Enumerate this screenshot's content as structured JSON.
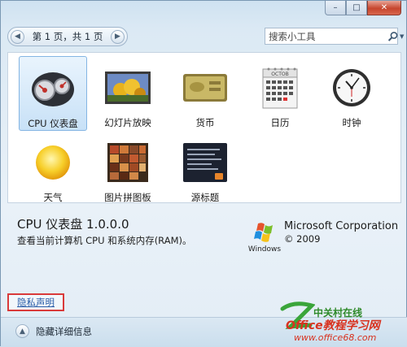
{
  "window": {
    "minimize_glyph": "–",
    "restore_glyph": "□",
    "close_glyph": "✕"
  },
  "pager": {
    "text": "第 1 页，共 1 页"
  },
  "search": {
    "placeholder": "搜索小工具"
  },
  "gadgets": [
    {
      "label": "CPU 仪表盘",
      "icon": "cpu-meter-icon",
      "selected": true
    },
    {
      "label": "幻灯片放映",
      "icon": "slideshow-icon",
      "selected": false
    },
    {
      "label": "货币",
      "icon": "currency-icon",
      "selected": false
    },
    {
      "label": "日历",
      "icon": "calendar-icon",
      "selected": false
    },
    {
      "label": "时钟",
      "icon": "clock-icon",
      "selected": false
    },
    {
      "label": "天气",
      "icon": "weather-icon",
      "selected": false
    },
    {
      "label": "图片拼图板",
      "icon": "picture-puzzle-icon",
      "selected": false
    },
    {
      "label": "源标题",
      "icon": "feed-headlines-icon",
      "selected": false
    }
  ],
  "calendar_month": "OCTOB",
  "details": {
    "title": "CPU 仪表盘 1.0.0.0",
    "description": "查看当前计算机 CPU 和系统内存(RAM)。",
    "publisher": "Microsoft Corporation",
    "copyright": "© 2009",
    "logo_text": "Windows"
  },
  "privacy_link": "隐私声明",
  "toggle_details": "隐藏详细信息",
  "watermark": {
    "line1": "中关村在线",
    "line2": "Office教程学习网",
    "url": "www.office68.com"
  },
  "colors": {
    "accent": "#84b5e3",
    "privacy_border": "#d93a3a",
    "close_button": "#c6452d"
  }
}
